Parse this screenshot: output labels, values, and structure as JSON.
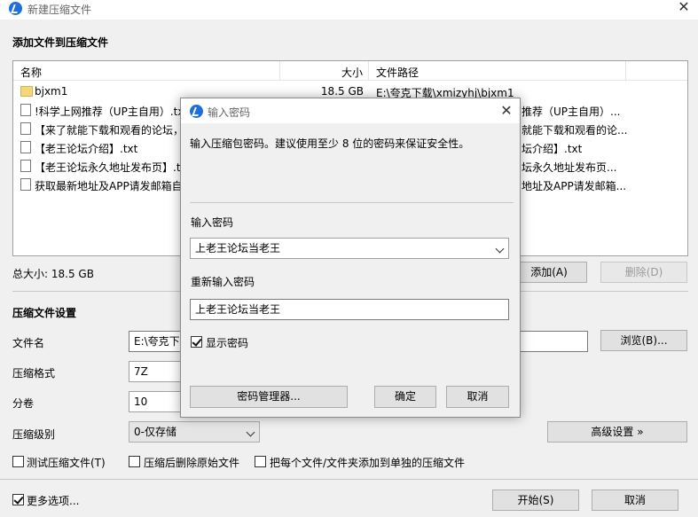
{
  "window": {
    "title": "新建压缩文件"
  },
  "files_section": {
    "title": "添加文件到压缩文件",
    "columns": {
      "name": "名称",
      "size": "大小",
      "path": "文件路径"
    },
    "rows": [
      {
        "name": "bjxm1",
        "size": "18.5 GB",
        "path": "E:\\夸克下载\\xmizyhj\\bjxm1",
        "icon": "folder-icon"
      },
      {
        "name": "!科学上网推荐（UP主自用）.txt",
        "size": "",
        "path": "推荐（UP主自用）...",
        "icon": "text-file-icon"
      },
      {
        "name": "【来了就能下载和观看的论坛，",
        "size": "",
        "path": "就能下载和观看的论...",
        "icon": "text-file-icon"
      },
      {
        "name": "【老王论坛介绍】.txt",
        "size": "",
        "path": "坛介绍】.txt",
        "icon": "text-file-icon"
      },
      {
        "name": "【老王论坛永久地址发布页】.tx",
        "size": "",
        "path": "坛永久地址发布页...",
        "icon": "text-file-icon"
      },
      {
        "name": "获取最新地址及APP请发邮箱自",
        "size": "",
        "path": "地址及APP请发邮箱...",
        "icon": "text-file-icon"
      }
    ],
    "total_size": "总大小: 18.5 GB",
    "add_button": "添加(A)",
    "delete_button": "删除(D)"
  },
  "settings": {
    "title": "压缩文件设置",
    "filename_label": "文件名",
    "filename_value": "E:\\夸克下载",
    "browse_button": "浏览(B)...",
    "format_label": "压缩格式",
    "format_value": "7Z",
    "split_label": "分卷",
    "split_value": "10",
    "level_label": "压缩级别",
    "level_value": "0-仅存储",
    "advanced_button": "高级设置 »",
    "test_archive": "测试压缩文件(T)",
    "delete_after": "压缩后删除原始文件",
    "separate_archives": "把每个文件/文件夹添加到单独的压缩文件",
    "more_options": "更多选项...",
    "start_button": "开始(S)",
    "cancel_button": "取消"
  },
  "password_dialog": {
    "title": "输入密码",
    "description": "输入压缩包密码。建议使用至少 8 位的密码来保证安全性。",
    "password_label": "输入密码",
    "password_value": "上老王论坛当老王",
    "confirm_label": "重新输入密码",
    "confirm_value": "上老王论坛当老王",
    "show_password": "显示密码",
    "show_password_checked": true,
    "manager_button": "密码管理器...",
    "ok_button": "确定",
    "cancel_button": "取消"
  }
}
